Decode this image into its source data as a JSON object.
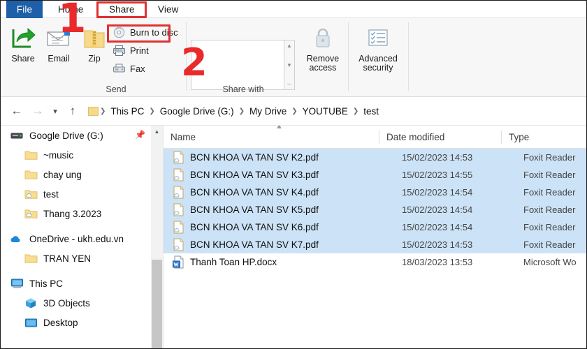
{
  "window": {
    "tabs": [
      {
        "label": "File",
        "icon": "file-tab"
      },
      {
        "label": "Home",
        "icon": "home-tab"
      },
      {
        "label": "Share",
        "icon": "share-tab"
      },
      {
        "label": "View",
        "icon": "view-tab"
      }
    ]
  },
  "ribbon": {
    "groups": [
      {
        "label": "Send"
      },
      {
        "label": "Share with"
      }
    ],
    "big_buttons": [
      {
        "label": "Share",
        "icon": "share-arrow-icon"
      },
      {
        "label": "Email",
        "icon": "envelope-icon"
      },
      {
        "label": "Zip",
        "icon": "zip-folder-icon"
      }
    ],
    "small_buttons": [
      {
        "label": "Burn to disc",
        "icon": "disc-icon"
      },
      {
        "label": "Print",
        "icon": "printer-icon"
      },
      {
        "label": "Fax",
        "icon": "fax-icon"
      }
    ],
    "share_with_buttons": [
      {
        "label_line1": "Remove",
        "label_line2": "access",
        "icon": "lock-icon"
      },
      {
        "label_line1": "Advanced",
        "label_line2": "security",
        "icon": "permissions-list-icon"
      }
    ]
  },
  "annotations": [
    {
      "text": "1",
      "color": "#ea2a2a"
    },
    {
      "text": "2",
      "color": "#ea2a2a"
    }
  ],
  "highlight_color": "#e03131",
  "accent_color": "#1d5fa8",
  "selection_color": "#cce3f7",
  "addressbar": {
    "back_icon": "arrow-left-icon",
    "forward_icon": "arrow-right-icon",
    "recent_icon": "chevron-down-icon",
    "up_icon": "arrow-up-icon",
    "folder_icon": "folder-icon",
    "crumbs": [
      "This PC",
      "Google Drive (G:)",
      "My Drive",
      "YOUTUBE",
      "test"
    ]
  },
  "navpane": {
    "scroll_up_icon": "chevron-up-icon",
    "items": [
      {
        "label": "Google Drive (G:)",
        "icon": "drive-icon",
        "indent": 1,
        "pinned": true
      },
      {
        "label": "~music",
        "icon": "folder-icon",
        "indent": 2,
        "pinned": false
      },
      {
        "label": "chay ung",
        "icon": "folder-icon",
        "indent": 2,
        "pinned": false
      },
      {
        "label": "test",
        "icon": "folder-cloud-icon",
        "indent": 2,
        "pinned": false
      },
      {
        "label": "Thang 3.2023",
        "icon": "folder-cloud-icon",
        "indent": 2,
        "pinned": false
      },
      {
        "label": "OneDrive - ukh.edu.vn",
        "icon": "onedrive-icon",
        "indent": 1,
        "pinned": false,
        "gap_before": true
      },
      {
        "label": "TRAN YEN",
        "icon": "folder-icon",
        "indent": 2,
        "pinned": false
      },
      {
        "label": "This PC",
        "icon": "pc-icon",
        "indent": 1,
        "pinned": false,
        "gap_before": true
      },
      {
        "label": "3D Objects",
        "icon": "3d-objects-icon",
        "indent": 2,
        "pinned": false
      },
      {
        "label": "Desktop",
        "icon": "desktop-icon",
        "indent": 2,
        "pinned": false
      }
    ]
  },
  "filelist": {
    "sort_caret_icon": "chevron-up-icon",
    "columns": [
      "Name",
      "Date modified",
      "Type"
    ],
    "rows": [
      {
        "name": "BCN KHOA VA TAN SV K2.pdf",
        "date": "15/02/2023 14:53",
        "type": "Foxit Reader",
        "icon": "pdf-cloud-icon",
        "selected": true
      },
      {
        "name": "BCN KHOA VA TAN SV K3.pdf",
        "date": "15/02/2023 14:55",
        "type": "Foxit Reader",
        "icon": "pdf-cloud-icon",
        "selected": true
      },
      {
        "name": "BCN KHOA VA TAN SV K4.pdf",
        "date": "15/02/2023 14:54",
        "type": "Foxit Reader",
        "icon": "pdf-cloud-icon",
        "selected": true
      },
      {
        "name": "BCN KHOA VA TAN SV K5.pdf",
        "date": "15/02/2023 14:54",
        "type": "Foxit Reader",
        "icon": "pdf-cloud-icon",
        "selected": true
      },
      {
        "name": "BCN KHOA VA TAN SV K6.pdf",
        "date": "15/02/2023 14:54",
        "type": "Foxit Reader",
        "icon": "pdf-cloud-icon",
        "selected": true
      },
      {
        "name": "BCN KHOA VA TAN SV K7.pdf",
        "date": "15/02/2023 14:53",
        "type": "Foxit Reader",
        "icon": "pdf-cloud-icon",
        "selected": true
      },
      {
        "name": "Thanh Toan HP.docx",
        "date": "18/03/2023 13:53",
        "type": "Microsoft Wo",
        "icon": "docx-icon",
        "selected": false
      }
    ]
  }
}
